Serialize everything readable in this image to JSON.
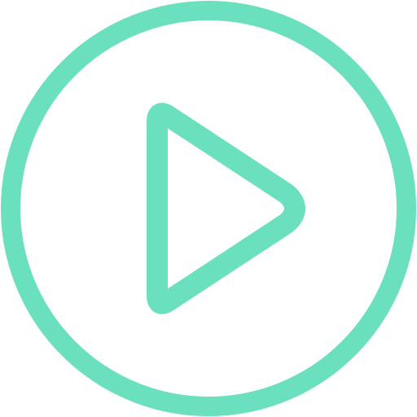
{
  "icon": {
    "name": "play-icon",
    "accent_color": "#6BE0BE",
    "background_color": "#FFFFFF"
  }
}
